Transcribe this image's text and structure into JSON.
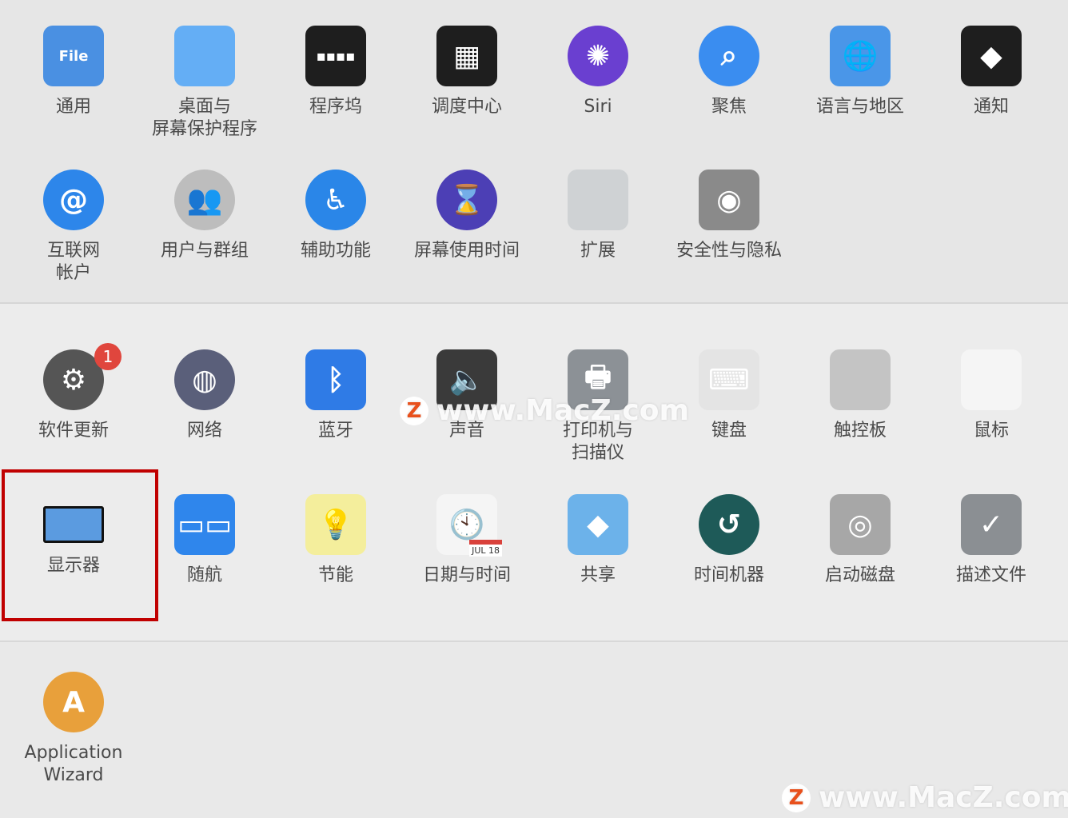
{
  "sections": [
    {
      "items": [
        {
          "label": "通用",
          "icon": "general-icon",
          "bg": "#4a90e2",
          "glyph": "File"
        },
        {
          "label": "桌面与\n屏幕保护程序",
          "icon": "desktop-screensaver-icon",
          "bg": "#64aef5",
          "glyph": ""
        },
        {
          "label": "程序坞",
          "icon": "dock-icon",
          "bg": "#1e1e1e",
          "glyph": "▪▪▪▪"
        },
        {
          "label": "调度中心",
          "icon": "mission-control-icon",
          "bg": "#1e1e1e",
          "glyph": "▦"
        },
        {
          "label": "Siri",
          "icon": "siri-icon",
          "bg": "#6a3fd0",
          "glyph": "✺"
        },
        {
          "label": "聚焦",
          "icon": "spotlight-icon",
          "bg": "#3a8df0",
          "glyph": "⌕"
        },
        {
          "label": "语言与地区",
          "icon": "language-region-flag-icon",
          "bg": "#4a96e8",
          "glyph": "🌐"
        },
        {
          "label": "通知",
          "icon": "notifications-icon",
          "bg": "#1e1e1e",
          "glyph": "◆"
        },
        {
          "label": "互联网\n帐户",
          "icon": "internet-accounts-icon",
          "bg": "#2d86ea",
          "glyph": "@"
        },
        {
          "label": "用户与群组",
          "icon": "users-groups-icon",
          "bg": "#bdbdbd",
          "glyph": "👥"
        },
        {
          "label": "辅助功能",
          "icon": "accessibility-icon",
          "bg": "#2a86e8",
          "glyph": "♿"
        },
        {
          "label": "屏幕使用时间",
          "icon": "screen-time-hourglass-icon",
          "bg": "#4c3fb5",
          "glyph": "⌛"
        },
        {
          "label": "扩展",
          "icon": "extensions-puzzle-icon",
          "bg": "#cfd2d4",
          "glyph": ""
        },
        {
          "label": "安全性与隐私",
          "icon": "security-privacy-house-icon",
          "bg": "#8a8a8a",
          "glyph": "◉"
        }
      ]
    },
    {
      "items": [
        {
          "label": "软件更新",
          "icon": "software-update-gear-icon",
          "bg": "#555555",
          "glyph": "⚙",
          "badge": "1"
        },
        {
          "label": "网络",
          "icon": "network-globe-icon",
          "bg": "#5a5f7a",
          "glyph": "◍"
        },
        {
          "label": "蓝牙",
          "icon": "bluetooth-icon",
          "bg": "#2f7be6",
          "glyph": "ᛒ"
        },
        {
          "label": "声音",
          "icon": "sound-speaker-icon",
          "bg": "#3a3a3a",
          "glyph": "🔈"
        },
        {
          "label": "打印机与\n扫描仪",
          "icon": "printer-icon",
          "bg": "#8c9196",
          "glyph": "🖶"
        },
        {
          "label": "键盘",
          "icon": "keyboard-icon",
          "bg": "#e4e4e4",
          "glyph": "⌨"
        },
        {
          "label": "触控板",
          "icon": "trackpad-icon",
          "bg": "#c4c4c4",
          "glyph": ""
        },
        {
          "label": "鼠标",
          "icon": "mouse-icon",
          "bg": "#f5f5f5",
          "glyph": ""
        },
        {
          "label": "显示器",
          "icon": "display-monitor-icon",
          "bg": "#5b9be0",
          "glyph": ""
        },
        {
          "label": "随航",
          "icon": "sidecar-icon",
          "bg": "#2f86ec",
          "glyph": "▭▭"
        },
        {
          "label": "节能",
          "icon": "energy-saver-bulb-icon",
          "bg": "#f4ee9c",
          "glyph": "💡"
        },
        {
          "label": "日期与时间",
          "icon": "date-time-clock-icon",
          "bg": "#f5f5f5",
          "glyph": "🕙",
          "calendar": "JUL 18"
        },
        {
          "label": "共享",
          "icon": "sharing-folder-icon",
          "bg": "#6cb2ea",
          "glyph": "◆"
        },
        {
          "label": "时间机器",
          "icon": "time-machine-icon",
          "bg": "#1e5a58",
          "glyph": "↺"
        },
        {
          "label": "启动磁盘",
          "icon": "startup-disk-icon",
          "bg": "#a7a7a7",
          "glyph": "◎"
        },
        {
          "label": "描述文件",
          "icon": "profiles-checkmark-icon",
          "bg": "#8b8f93",
          "glyph": "✓"
        }
      ]
    },
    {
      "items": [
        {
          "label": "Application\nWizard",
          "icon": "application-wizard-icon",
          "bg": "#e8a03b",
          "glyph": "A"
        }
      ]
    }
  ],
  "highlighted_item": "显示器",
  "highlight_color": "#c00000",
  "watermark": {
    "text": "www.MacZ.com",
    "logo": "Z"
  }
}
